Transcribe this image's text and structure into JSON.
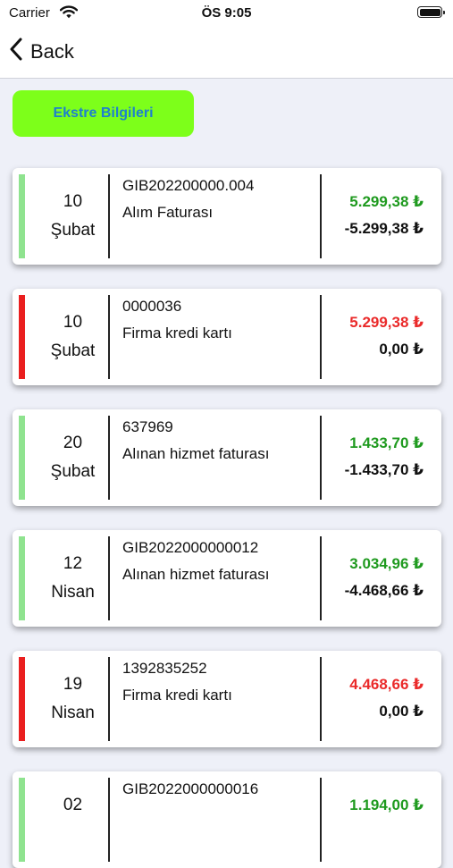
{
  "status_bar": {
    "carrier": "Carrier",
    "time": "ÖS 9:05"
  },
  "nav": {
    "back_label": "Back"
  },
  "ekstre_button": "Ekstre Bilgileri",
  "colors": {
    "income_stripe": "#8fe38f",
    "expense_stripe": "#ea1f1f",
    "green_amount": "#1f9a1f",
    "red_amount": "#ea2a2a",
    "button_bg": "#7dff1a",
    "button_text": "#1e7fcf"
  },
  "transactions": [
    {
      "day": "10",
      "month": "Şubat",
      "doc_no": "GIB202200000.004",
      "description": "Alım Faturası",
      "amount": "5.299,38 ₺",
      "balance": "-5.299,38 ₺",
      "type": "income"
    },
    {
      "day": "10",
      "month": "Şubat",
      "doc_no": "0000036",
      "description": "Firma kredi kartı",
      "amount": "5.299,38 ₺",
      "balance": "0,00 ₺",
      "type": "expense"
    },
    {
      "day": "20",
      "month": "Şubat",
      "doc_no": "637969",
      "description": "Alınan hizmet faturası",
      "amount": "1.433,70 ₺",
      "balance": "-1.433,70 ₺",
      "type": "income"
    },
    {
      "day": "12",
      "month": "Nisan",
      "doc_no": "GIB2022000000012",
      "description": "Alınan hizmet faturası",
      "amount": "3.034,96 ₺",
      "balance": "-4.468,66 ₺",
      "type": "income"
    },
    {
      "day": "19",
      "month": "Nisan",
      "doc_no": "1392835252",
      "description": "Firma kredi kartı",
      "amount": "4.468,66 ₺",
      "balance": "0,00 ₺",
      "type": "expense"
    },
    {
      "day": "02",
      "month": "",
      "doc_no": "GIB2022000000016",
      "description": "",
      "amount": "1.194,00 ₺",
      "balance": "",
      "type": "income"
    }
  ]
}
